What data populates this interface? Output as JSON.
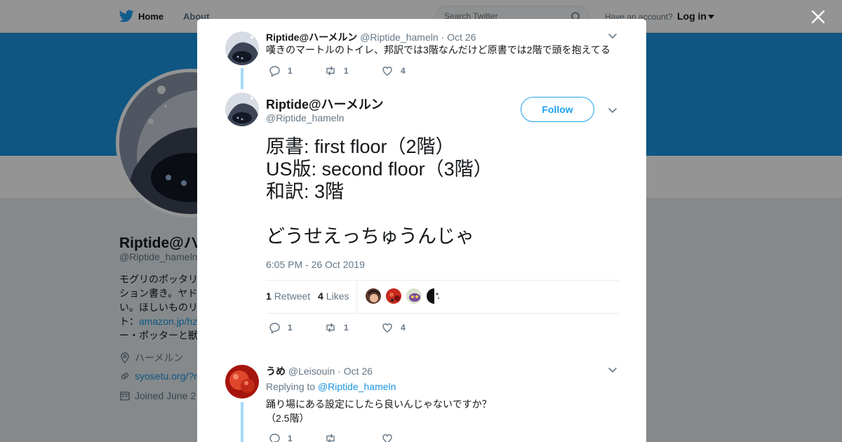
{
  "topbar": {
    "home_label": "Home",
    "about_label": "About",
    "search_placeholder": "Search Twitter",
    "have_account": "Have an account?",
    "login_label": "Log in"
  },
  "profile": {
    "name": "Riptide@ハ",
    "handle": "@Riptide_hameln",
    "bio_lines": [
      "モグリのポッタリ",
      "ション書き。ヤド",
      "い。ほしいものリ",
      "ト："
    ],
    "bio_link": "amazon.jp/hz",
    "bio_last": "ー・ポッターと獣",
    "location": "ハーメルン",
    "url": "syosetu.org/?r",
    "joined": "Joined June 2"
  },
  "tweet1": {
    "name": "Riptide@ハーメルン",
    "handle": "@Riptide_hameln",
    "dot": "·",
    "date": "Oct 26",
    "text": "嘆きのマートルのトイレ、邦訳では3階なんだけど原書では2階で頭を抱えてる",
    "replies": "1",
    "retweets": "1",
    "likes": "4"
  },
  "main_tweet": {
    "name": "Riptide@ハーメルン",
    "handle": "@Riptide_hameln",
    "follow_label": "Follow",
    "lines": [
      "原書: first floor（2階）",
      "US版: second floor（3階）",
      "和訳: 3階",
      "",
      "どうせえっちゅうんじゃ"
    ],
    "timestamp": "6:05 PM - 26 Oct 2019",
    "retweet_count": "1",
    "retweet_label": "Retweet",
    "like_count": "4",
    "like_label": "Likes",
    "replies": "1",
    "retweets": "1",
    "likes": "4"
  },
  "reply_tweet": {
    "name": "うめ",
    "handle": "@Leisouin",
    "dot": "·",
    "date": "Oct 26",
    "replying_prefix": "Replying to",
    "replying_handle": "@Riptide_hameln",
    "line1": "踊り場にある設定にしたら良いんじゃないですか？",
    "line2": "（2.5階）",
    "replies": "1"
  },
  "colors": {
    "accent": "#1da1f2",
    "link": "#1b95e0",
    "banner": "#1b95e0",
    "thread_line": "#a4d9f9",
    "secondary_text": "#657786"
  }
}
